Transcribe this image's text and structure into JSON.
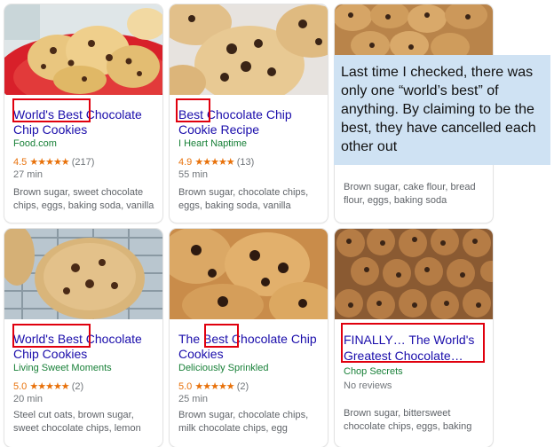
{
  "cards": [
    {
      "title": "World's Best Chocolate Chip Cookies",
      "source": "Food.com",
      "rating_value": "4.5",
      "stars": "★★★★★",
      "count": "(217)",
      "time": "27 min",
      "ingredients": "Brown sugar, sweet chocolate chips, eggs, baking soda, vanilla"
    },
    {
      "title": "Best Chocolate Chip Cookie Recipe",
      "source": "I Heart Naptime",
      "rating_value": "4.9",
      "stars": "★★★★★",
      "count": "(13)",
      "time": "55 min",
      "ingredients": "Brown sugar, chocolate chips, eggs, baking soda, vanilla"
    },
    {
      "ingredients": "Brown sugar, cake flour, bread flour, eggs, baking soda"
    },
    {
      "title": "World's Best Chocolate Chip Cookies",
      "source": "Living Sweet Moments",
      "rating_value": "5.0",
      "stars": "★★★★★",
      "count": "(2)",
      "time": "20 min",
      "ingredients": "Steel cut oats, brown sugar, sweet chocolate chips, lemon"
    },
    {
      "title": "The Best Chocolate Chip Cookies",
      "source": "Deliciously Sprinkled",
      "rating_value": "5.0",
      "stars": "★★★★★",
      "count": "(2)",
      "time": "25 min",
      "ingredients": "Brown sugar, chocolate chips, milk chocolate chips, egg"
    },
    {
      "title": "FINALLY… The World's Greatest Chocolate…",
      "source": "Chop Secrets",
      "reviews": "No reviews",
      "ingredients": "Brown sugar, bittersweet chocolate chips, eggs, baking"
    }
  ],
  "callout": "Last time I checked, there was only one “world’s best” of anything. By claiming to be the best, they have cancelled each other out",
  "colors": {
    "link": "#1a0dab",
    "source": "#188038",
    "star": "#e8710a",
    "highlight": "#e0000e",
    "callout_bg": "#cfe2f3"
  }
}
